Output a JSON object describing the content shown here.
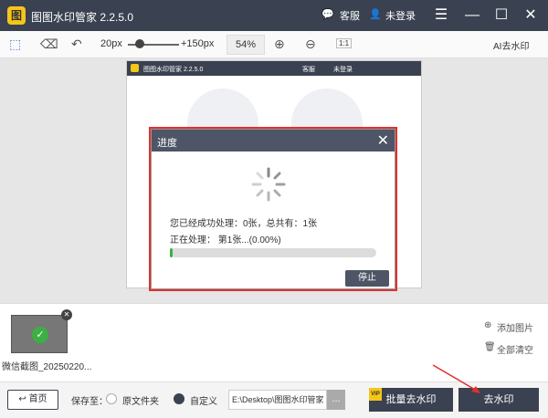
{
  "app": {
    "title": "图图水印管家  2.2.5.0",
    "logo_char": "图",
    "service": "客服",
    "login": "未登录"
  },
  "toolbar": {
    "zoom_min": "20px",
    "zoom_max": "+150px",
    "zoom_pct": "54%",
    "ratio": "1:1",
    "ai_label": "AI去水印"
  },
  "inner": {
    "title": "图图水印管家  2.2.5.0",
    "service": "客服",
    "login": "未登录"
  },
  "dialog": {
    "title": "进度",
    "processed": "您已经成功处理：0张，总共有：1张",
    "current": "正在处理：    第1张...(0.00%)",
    "progress": 0.0,
    "stop": "停止"
  },
  "thumbs": {
    "name": "微信截图_20250220...",
    "add": "添加图片",
    "clear": "全部清空"
  },
  "bottom": {
    "home": "首页",
    "save_to": "保存至：",
    "opt_original": "原文件夹",
    "opt_custom": "自定义",
    "path": "E:\\Desktop\\图图水印管家",
    "browse": "...",
    "batch": "批量去水印",
    "vip": "VIP",
    "remove": "去水印"
  },
  "colors": {
    "dark": "#3a4150",
    "accent": "#f5c518",
    "highlight": "#e03030",
    "progress": "#3cb043"
  }
}
